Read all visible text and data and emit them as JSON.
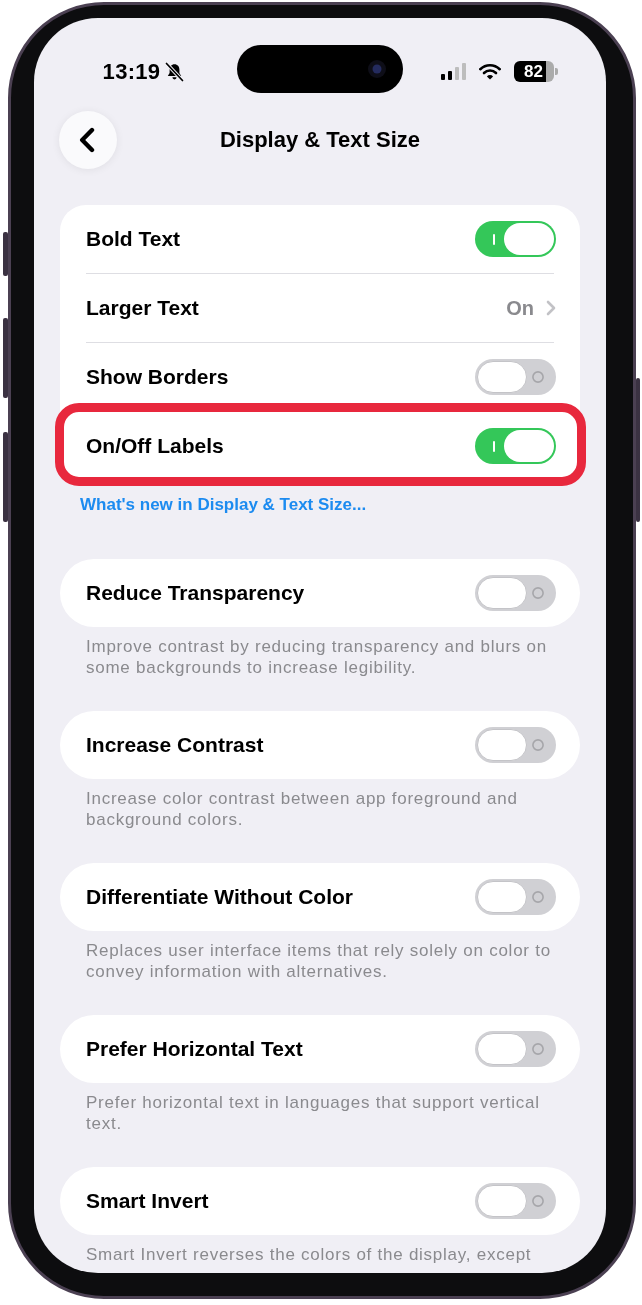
{
  "status_bar": {
    "time": "13:19",
    "battery": "82"
  },
  "navigation": {
    "title": "Display & Text Size"
  },
  "groups": [
    {
      "rows": [
        {
          "kind": "toggle",
          "label": "Bold Text",
          "on": true,
          "highlighted": false
        },
        {
          "kind": "link",
          "label": "Larger Text",
          "value": "On",
          "highlighted": false
        },
        {
          "kind": "toggle",
          "label": "Show Borders",
          "on": false,
          "highlighted": false
        },
        {
          "kind": "toggle",
          "label": "On/Off Labels",
          "on": true,
          "highlighted": true
        }
      ],
      "footer_link": "What's new in Display & Text Size..."
    },
    {
      "rows": [
        {
          "kind": "toggle",
          "label": "Reduce Transparency",
          "on": false,
          "highlighted": false
        }
      ],
      "footer": "Improve contrast by reducing transparency and blurs on some backgrounds to increase legibility."
    },
    {
      "rows": [
        {
          "kind": "toggle",
          "label": "Increase Contrast",
          "on": false,
          "highlighted": false
        }
      ],
      "footer": "Increase color contrast between app foreground and background colors."
    },
    {
      "rows": [
        {
          "kind": "toggle",
          "label": "Differentiate Without Color",
          "on": false,
          "highlighted": false
        }
      ],
      "footer": "Replaces user interface items that rely solely on color to convey information with alternatives."
    },
    {
      "rows": [
        {
          "kind": "toggle",
          "label": "Prefer Horizontal Text",
          "on": false,
          "highlighted": false
        }
      ],
      "footer": "Prefer horizontal text in languages that support vertical text."
    },
    {
      "rows": [
        {
          "kind": "toggle",
          "label": "Smart Invert",
          "on": false,
          "highlighted": false
        }
      ],
      "footer": "Smart Invert reverses the colors of the display, except"
    }
  ]
}
